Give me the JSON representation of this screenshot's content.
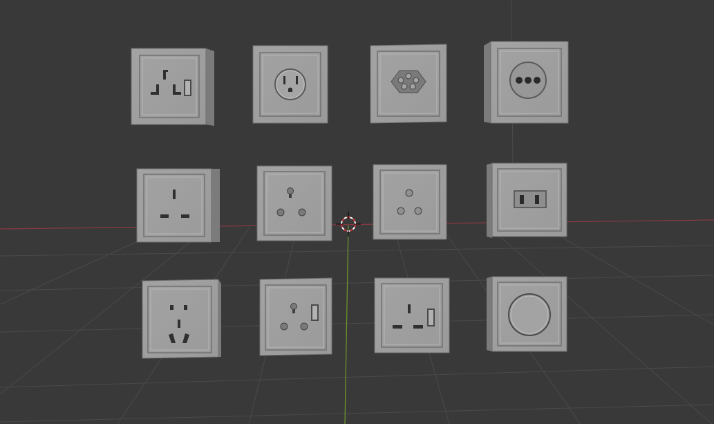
{
  "viewport": {
    "mode": "3d-viewport-solid",
    "background_color": "#393939",
    "grid_color": "#4a4a4a",
    "x_axis_color": "#8a3a44",
    "y_axis_color": "#6f9a2a",
    "cursor_colors": [
      "#d03a3a",
      "#ffffff"
    ]
  },
  "objects": [
    {
      "name": "outlet-type-g-switched",
      "row": 1,
      "col": 1
    },
    {
      "name": "outlet-type-b",
      "row": 1,
      "col": 2
    },
    {
      "name": "outlet-type-j",
      "row": 1,
      "col": 3
    },
    {
      "name": "outlet-type-h",
      "row": 1,
      "col": 4
    },
    {
      "name": "outlet-type-g",
      "row": 2,
      "col": 1
    },
    {
      "name": "outlet-type-d",
      "row": 2,
      "col": 2
    },
    {
      "name": "outlet-type-m",
      "row": 2,
      "col": 3
    },
    {
      "name": "outlet-switch-rocker",
      "row": 2,
      "col": 4
    },
    {
      "name": "outlet-type-a-i-combo",
      "row": 3,
      "col": 1
    },
    {
      "name": "outlet-type-d-switched",
      "row": 3,
      "col": 2
    },
    {
      "name": "outlet-type-g-switched-2",
      "row": 3,
      "col": 3
    },
    {
      "name": "outlet-round-dimmer",
      "row": 3,
      "col": 4
    }
  ]
}
